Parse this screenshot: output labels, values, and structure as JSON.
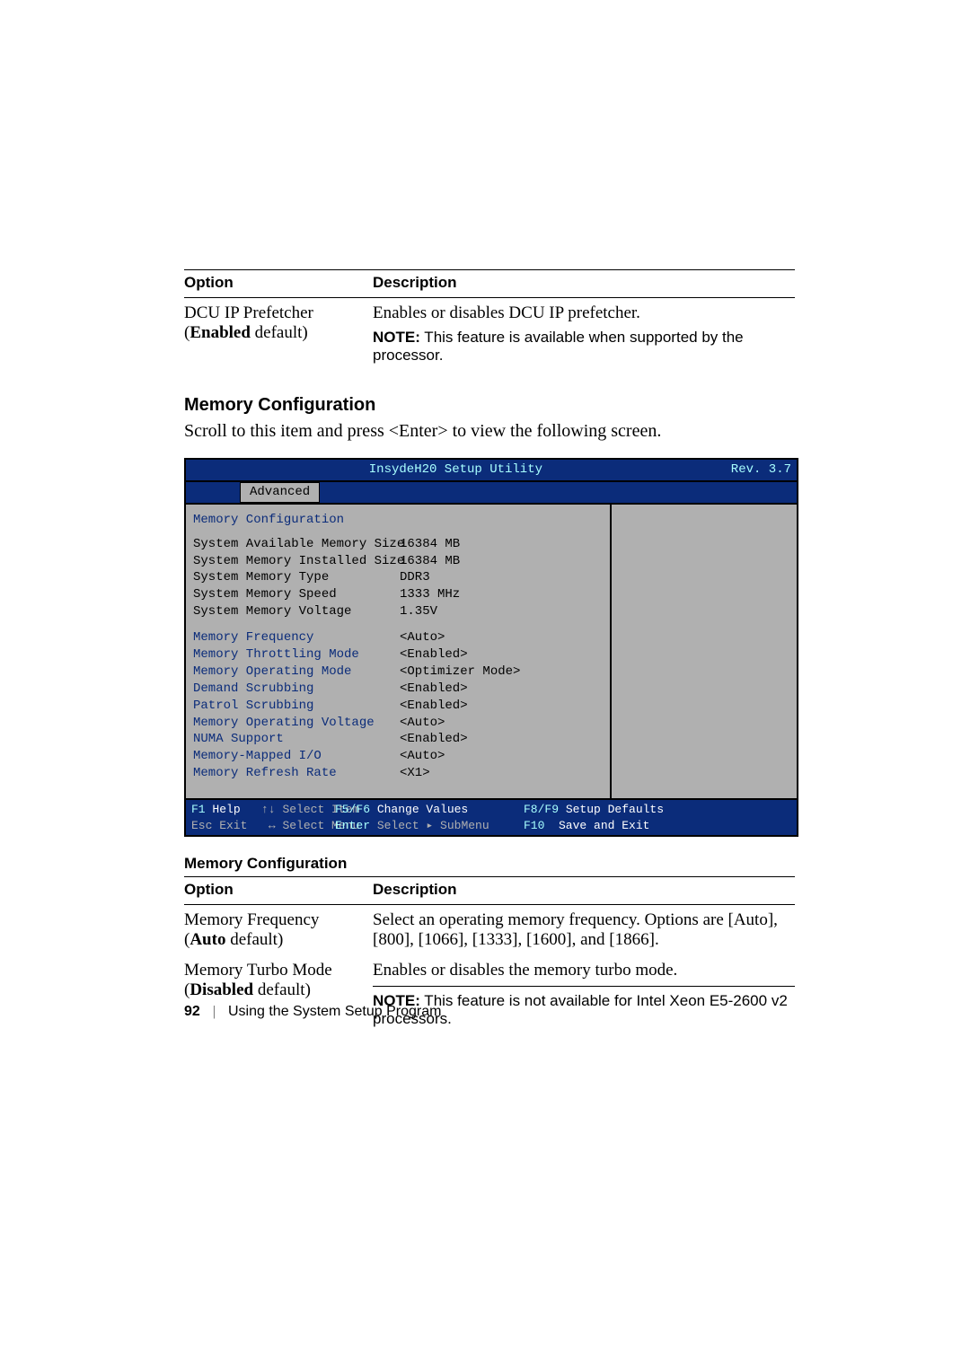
{
  "table1": {
    "headers": {
      "option": "Option",
      "description": "Description"
    },
    "row": {
      "option_name": "DCU IP Prefetcher",
      "option_default": "(Enabled default)",
      "desc_line": "Enables or disables DCU IP prefetcher.",
      "note_label": "NOTE:",
      "note_text": " This feature is available when supported by the processor."
    }
  },
  "section": {
    "heading": "Memory Configuration",
    "intro": "Scroll to this item and press <Enter> to view the following screen."
  },
  "bios": {
    "title": "InsydeH20 Setup Utility",
    "rev": "Rev. 3.7",
    "active_tab": "Advanced",
    "panel_header": "Memory Configuration",
    "ro": [
      {
        "k": "System Available Memory Size",
        "v": "16384 MB"
      },
      {
        "k": "System Memory Installed Size",
        "v": "16384 MB"
      },
      {
        "k": "System Memory Type",
        "v": "DDR3"
      },
      {
        "k": "System Memory Speed",
        "v": "1333 MHz"
      },
      {
        "k": "System Memory Voltage",
        "v": "1.35V"
      }
    ],
    "rw": [
      {
        "k": "Memory Frequency",
        "v": "<Auto>"
      },
      {
        "k": "Memory Throttling Mode",
        "v": "<Enabled>"
      },
      {
        "k": "Memory Operating Mode",
        "v": "<Optimizer Mode>"
      },
      {
        "k": "Demand Scrubbing",
        "v": "<Enabled>"
      },
      {
        "k": "Patrol Scrubbing",
        "v": "<Enabled>"
      },
      {
        "k": "Memory Operating Voltage",
        "v": "<Auto>"
      },
      {
        "k": "NUMA Support",
        "v": "<Enabled>"
      },
      {
        "k": "Memory-Mapped I/O",
        "v": "<Auto>"
      },
      {
        "k": "Memory Refresh Rate",
        "v": "<X1>"
      }
    ],
    "footer": {
      "f1": "F1",
      "f1_txt": " Help",
      "updn": "↑↓",
      "updn_txt": " Select Item",
      "f5f6": "F5/F6",
      "f5f6_txt": " Change Values",
      "f8f9": "F8/F9",
      "f8f9_txt": " Setup Defaults",
      "esc": "Esc",
      "esc_txt": " Exit",
      "lr": "↔",
      "lr_txt": " Select Menu",
      "enter": "Enter",
      "enter_txt": " Select ▸ SubMenu",
      "f10": "F10",
      "f10_txt": "  Save and Exit"
    }
  },
  "table2": {
    "title": "Memory Configuration",
    "headers": {
      "option": "Option",
      "description": "Description"
    },
    "rows": [
      {
        "option_name": "Memory Frequency",
        "option_default": "(Auto default)",
        "desc": "Select an operating memory frequency. Options are [Auto], [800], [1066], [1333], [1600], and [1866]."
      },
      {
        "option_name": "Memory Turbo Mode",
        "option_default": "(Disabled default)",
        "desc_line": "Enables or disables the memory turbo mode.",
        "note_label": "NOTE:",
        "note_text": " This feature is not available for Intel Xeon E5-2600 v2 processors."
      }
    ]
  },
  "pagefoot": {
    "number": "92",
    "section": "Using the System Setup Program"
  }
}
